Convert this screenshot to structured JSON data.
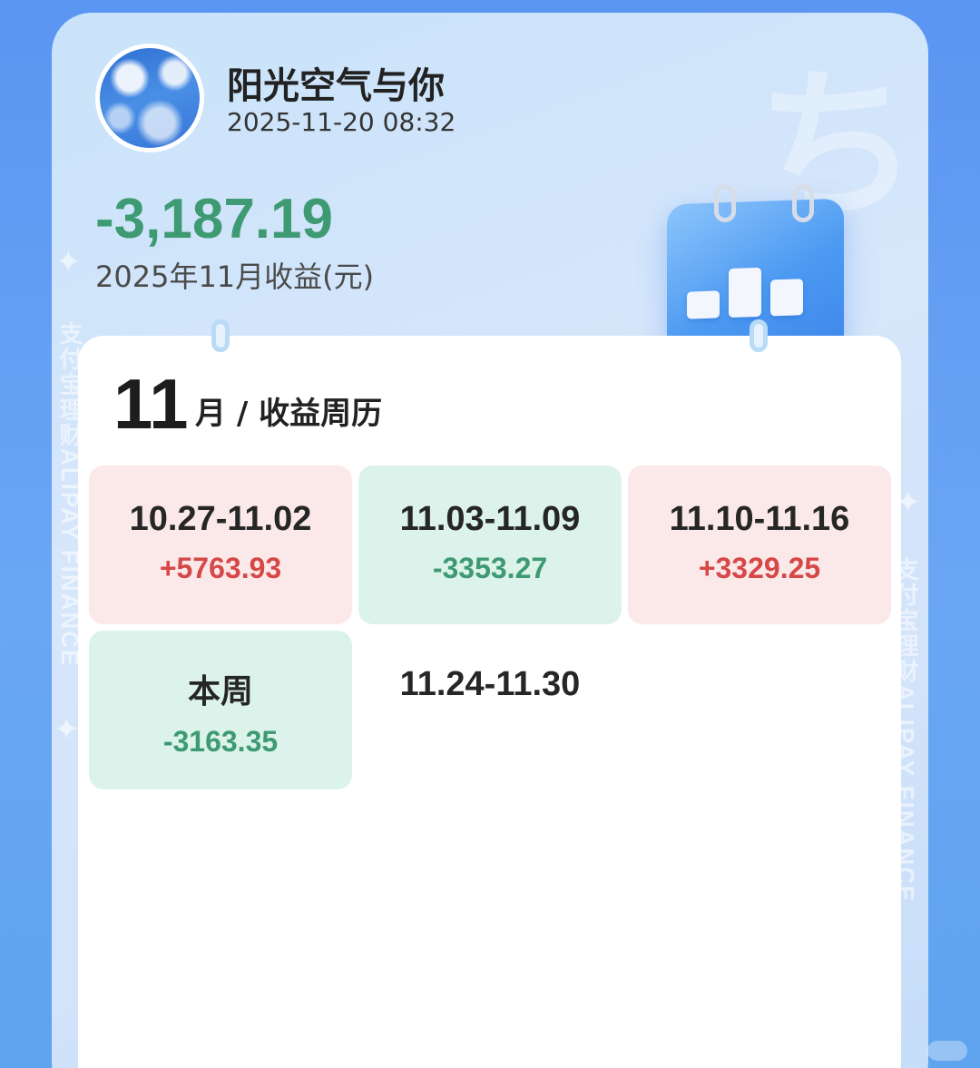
{
  "profile": {
    "username": "阳光空气与你",
    "timestamp": "2025-11-20 08:32"
  },
  "summary": {
    "income": "-3,187.19",
    "label": "2025年11月收益(元)"
  },
  "calendar": {
    "month_number": "11",
    "month_title": "月 / 收益周历",
    "weeks": [
      {
        "range": "10.27-11.02",
        "amount": "+5763.93",
        "status": "up"
      },
      {
        "range": "11.03-11.09",
        "amount": "-3353.27",
        "status": "down"
      },
      {
        "range": "11.10-11.16",
        "amount": "+3329.25",
        "status": "up"
      },
      {
        "range": "本周",
        "amount": "-3163.35",
        "status": "down"
      },
      {
        "range": "11.24-11.30",
        "amount": "",
        "status": "none"
      }
    ]
  },
  "watermark": {
    "text": "支付宝理财ALIPAY FINANCE"
  },
  "colors": {
    "positive": "#d64848",
    "negative": "#3e9a72",
    "positive_bg": "#fbe9ea",
    "negative_bg": "#dcf3ec"
  },
  "icons": [
    "avatar-image",
    "calendar-chart-icon",
    "sparkle-icon"
  ]
}
